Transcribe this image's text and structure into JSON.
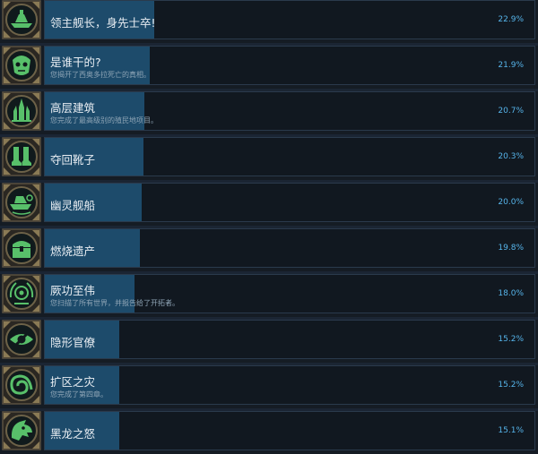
{
  "achievements": [
    {
      "title": "领主舰长，身先士卒!",
      "desc": "",
      "percent_label": "22.9%",
      "percent": 22.9,
      "icon": "armored-ship-icon"
    },
    {
      "title": "是谁干的?",
      "desc": "您揭开了西奥多拉死亡的真相。",
      "percent_label": "21.9%",
      "percent": 21.9,
      "icon": "skull-face-icon"
    },
    {
      "title": "高层建筑",
      "desc": "您完成了最高级别的殖民地项目。",
      "percent_label": "20.7%",
      "percent": 20.7,
      "icon": "spire-city-icon"
    },
    {
      "title": "夺回靴子",
      "desc": "",
      "percent_label": "20.3%",
      "percent": 20.3,
      "icon": "boots-icon"
    },
    {
      "title": "幽灵舰船",
      "desc": "",
      "percent_label": "20.0%",
      "percent": 20.0,
      "icon": "ghost-ship-icon"
    },
    {
      "title": "燃烧遗产",
      "desc": "",
      "percent_label": "19.8%",
      "percent": 19.8,
      "icon": "chest-icon"
    },
    {
      "title": "厥功至伟",
      "desc": "您扫描了所有世界，并报告给了开拓者。",
      "percent_label": "18.0%",
      "percent": 18.0,
      "icon": "scanner-wreath-icon"
    },
    {
      "title": "隐形官僚",
      "desc": "",
      "percent_label": "15.2%",
      "percent": 15.2,
      "icon": "hidden-eye-icon"
    },
    {
      "title": "扩区之灾",
      "desc": "您完成了第四章。",
      "percent_label": "15.2%",
      "percent": 15.2,
      "icon": "vortex-wave-icon"
    },
    {
      "title": "黑龙之怒",
      "desc": "",
      "percent_label": "15.1%",
      "percent": 15.1,
      "icon": "dragon-head-icon"
    }
  ],
  "colors": {
    "bar": "#1d4b6b",
    "percent_text": "#56b4ea",
    "icon_glyph": "#58c06a"
  }
}
